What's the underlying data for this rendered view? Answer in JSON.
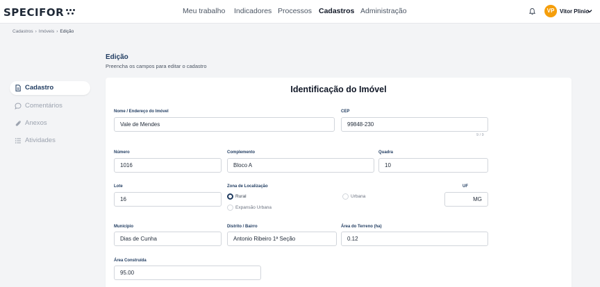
{
  "header": {
    "logo": "SPECIFOR",
    "nav": [
      "Meu trabalho",
      "Indicadores",
      "Processos",
      "Cadastros",
      "Administração"
    ],
    "active_nav": "Cadastros",
    "user_initials": "VP",
    "user_name": "Vitor Plinio",
    "icons": [
      "bell-icon",
      "chevron-down-icon"
    ]
  },
  "breadcrumb": [
    "Cadastros",
    "Imóveis",
    "Edição"
  ],
  "page": {
    "title": "Edição",
    "subtitle": "Preencha os campos para editar o cadastro"
  },
  "sidebar": {
    "items": [
      {
        "label": "Cadastro",
        "icon": "document-icon",
        "active": true
      },
      {
        "label": "Comentários",
        "icon": "chat-icon",
        "active": false
      },
      {
        "label": "Anexos",
        "icon": "paperclip-icon",
        "active": false
      },
      {
        "label": "Atividades",
        "icon": "list-icon",
        "active": false
      }
    ]
  },
  "form": {
    "title": "Identificação do Imóvel",
    "nome": {
      "label": "Nome / Endereço do Imóvel",
      "value": "Vale de Mendes"
    },
    "cep": {
      "label": "CEP",
      "value": "99848-230",
      "counter": "9 / 9"
    },
    "numero": {
      "label": "Número",
      "value": "1016"
    },
    "complemento": {
      "label": "Complemento",
      "value": "Bloco A"
    },
    "quadra": {
      "label": "Quadra",
      "value": "10"
    },
    "lote": {
      "label": "Lote",
      "value": "16"
    },
    "zona": {
      "label": "Zona de Localização",
      "options": [
        "Rural",
        "Urbana",
        "Expansão Urbana"
      ],
      "selected": "Rural"
    },
    "uf": {
      "label": "UF",
      "value": "MG"
    },
    "municipio": {
      "label": "Município",
      "value": "Dias de Cunha"
    },
    "distrito": {
      "label": "Distrito / Bairro",
      "value": "Antonio Ribeiro 1ª Seção"
    },
    "area_terreno": {
      "label": "Área do Terreno (ha)",
      "value": "0.12"
    },
    "area_construida": {
      "label": "Área Construída",
      "value": "95.00"
    }
  },
  "colors": {
    "accent": "#1e3a5f",
    "avatar": "#f59e0b",
    "background": "#f3f4f6"
  }
}
